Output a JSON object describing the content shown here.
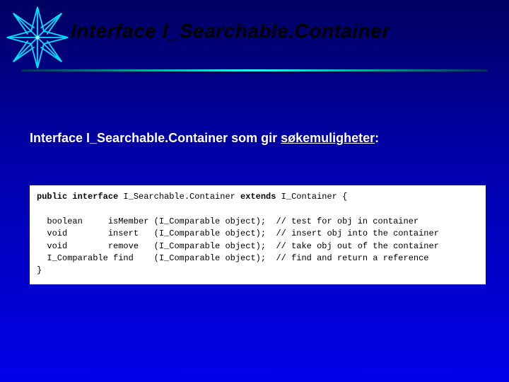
{
  "title": "Interface   I_Searchable.Container",
  "subtitle_prefix": "Interface I_Searchable.Container som gir ",
  "subtitle_underlined": "søkemuligheter",
  "subtitle_suffix": ":",
  "code": {
    "decl_prefix": "public interface",
    "decl_name": " I_Searchable.Container ",
    "decl_extends": "extends",
    "decl_parent": " I_Container {",
    "rows": [
      {
        "ret": "boolean     ",
        "name": "isMember ",
        "args": "(I_Comparable object);  ",
        "comment": "// test for obj in container"
      },
      {
        "ret": "void        ",
        "name": "insert   ",
        "args": "(I_Comparable object);  ",
        "comment": "// insert obj into the container"
      },
      {
        "ret": "void        ",
        "name": "remove   ",
        "args": "(I_Comparable object);  ",
        "comment": "// take obj out of the container"
      },
      {
        "ret": "I_Comparable",
        "name": " find    ",
        "args": "(I_Comparable object);  ",
        "comment": "// find and return a reference"
      }
    ],
    "close": "}"
  }
}
